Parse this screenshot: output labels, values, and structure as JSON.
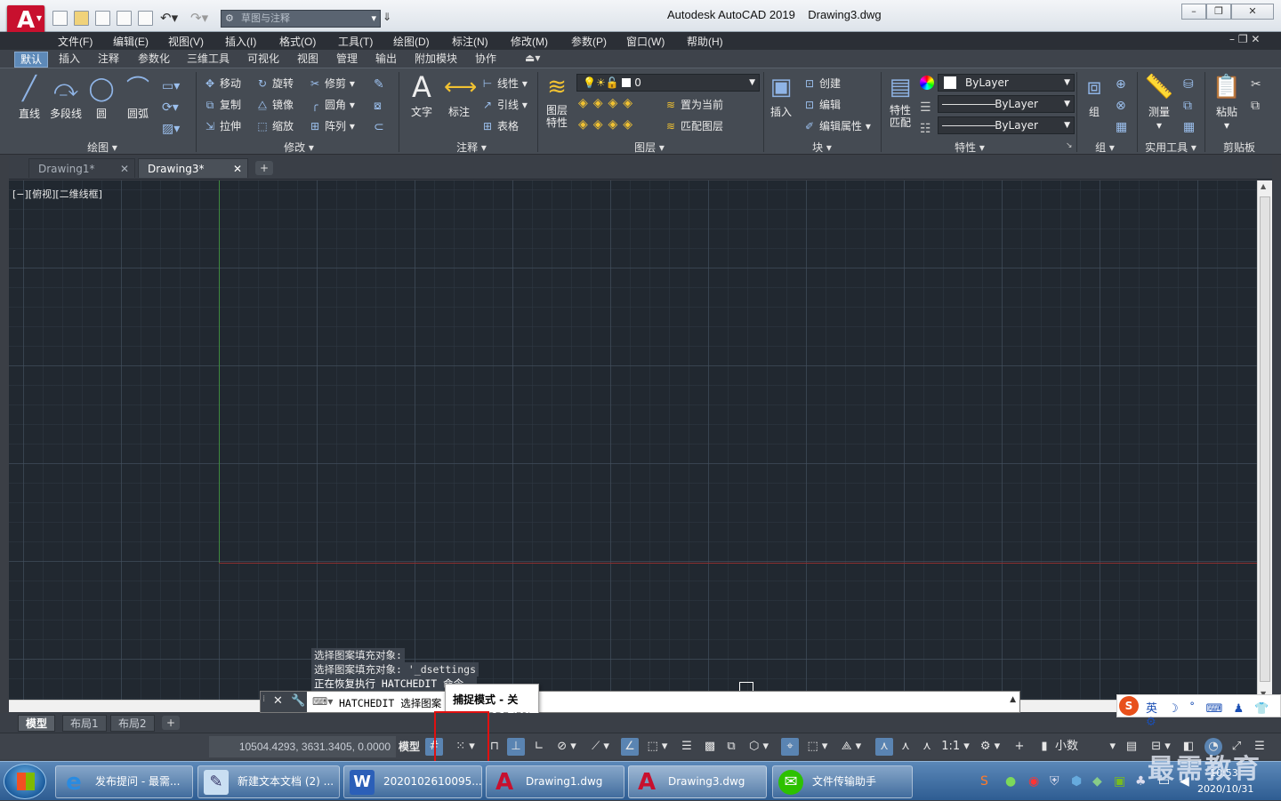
{
  "app": {
    "title": "Autodesk AutoCAD 2019",
    "document": "Drawing3.dwg",
    "logo_letter": "A",
    "workspace": "草图与注释"
  },
  "menu": [
    "文件(F)",
    "编辑(E)",
    "视图(V)",
    "插入(I)",
    "格式(O)",
    "工具(T)",
    "绘图(D)",
    "标注(N)",
    "修改(M)",
    "参数(P)",
    "窗口(W)",
    "帮助(H)"
  ],
  "ribbon_tabs": [
    "默认",
    "插入",
    "注释",
    "参数化",
    "三维工具",
    "可视化",
    "视图",
    "管理",
    "输出",
    "附加模块",
    "协作"
  ],
  "ribbon": {
    "draw": {
      "line": "直线",
      "polyline": "多段线",
      "circle": "圆",
      "arc": "圆弧",
      "label": "绘图"
    },
    "modify": {
      "move": "移动",
      "rotate": "旋转",
      "trim": "修剪",
      "copy": "复制",
      "mirror": "镜像",
      "fillet": "圆角",
      "stretch": "拉伸",
      "scale": "缩放",
      "array": "阵列",
      "label": "修改"
    },
    "annotation": {
      "text": "文字",
      "dimension": "标注",
      "linear": "线性",
      "leader": "引线",
      "table": "表格",
      "label": "注释"
    },
    "layers": {
      "props": "图层\n特性",
      "current_layer": "0",
      "set_current": "置为当前",
      "match_layer": "匹配图层",
      "label": "图层"
    },
    "block": {
      "insert": "插入",
      "create": "创建",
      "edit": "编辑",
      "edit_attr": "编辑属性",
      "label": "块"
    },
    "properties": {
      "match": "特性\n匹配",
      "color": "ByLayer",
      "linetype": "ByLayer",
      "lineweight": "ByLayer",
      "label": "特性"
    },
    "groups": {
      "group": "组",
      "label": "组"
    },
    "utilities": {
      "measure": "测量",
      "label": "实用工具"
    },
    "clipboard": {
      "paste": "粘贴",
      "label": "剪贴板"
    }
  },
  "file_tabs": [
    "Drawing1*",
    "Drawing3*"
  ],
  "viewport_label": "[−][俯视][二维线框]",
  "command_history": [
    "选择图案填充对象:",
    "选择图案填充对象:  '_dsettings",
    "正在恢复执行 HATCHEDIT 命令。"
  ],
  "command_line": "HATCHEDIT 选择图案",
  "tooltip": {
    "title": "捕捉模式 - 关",
    "subtitle": "SNAPMODE (F9)"
  },
  "layout_tabs": [
    "模型",
    "布局1",
    "布局2"
  ],
  "status": {
    "coords": "10504.4293, 3631.3405, 0.0000",
    "model": "模型",
    "scale": "1:1",
    "units": "小数"
  },
  "ime": {
    "text": "英"
  },
  "taskbar": [
    {
      "label": "发布提问 - 最需...",
      "icon": "ie-icon"
    },
    {
      "label": "新建文本文档 (2) ...",
      "icon": "notepad-icon"
    },
    {
      "label": "2020102610095...",
      "icon": "word-icon"
    },
    {
      "label": "Drawing1.dwg",
      "icon": "autocad-icon"
    },
    {
      "label": "Drawing3.dwg",
      "icon": "autocad-icon"
    },
    {
      "label": "文件传输助手",
      "icon": "wechat-icon"
    }
  ],
  "clock": {
    "time": "10:53",
    "date": "2020/10/31"
  },
  "watermark": "最需教育",
  "colors": {
    "canvas": "#212830",
    "ribbon": "#454b53",
    "accent": "#5d89b8",
    "red_highlight": "#e01010",
    "acad_red": "#c8102e"
  }
}
